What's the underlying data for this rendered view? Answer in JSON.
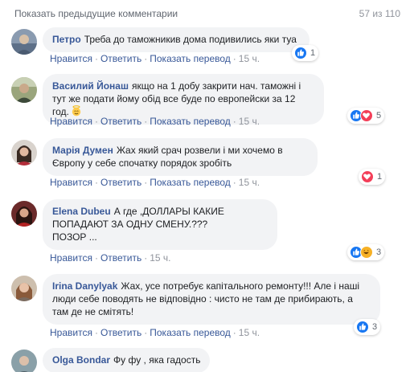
{
  "header": {
    "prev_comments_label": "Показать предыдущие комментарии",
    "count_label": "57 из 110"
  },
  "actions": {
    "like_label": "Нравится",
    "reply_label": "Ответить",
    "translate_label": "Показать перевод"
  },
  "comments": [
    {
      "author": "Петро",
      "text": "Треба до таможникив дома подивились яки туа",
      "translate": true,
      "time": "15 ч.",
      "reactions": [
        "like"
      ],
      "reaction_count": "1"
    },
    {
      "author": "Василий Йонаш",
      "text": "якщо на 1 добу закрити нач. таможні і тут же подати йому обід все буде по европейски за 12 год.",
      "emoji": "smiling-face-with-halo",
      "translate": true,
      "time": "15 ч.",
      "reactions": [
        "like",
        "love"
      ],
      "reaction_count": "5"
    },
    {
      "author": "Марія Думен",
      "text": "Жах який срач розвели і ми хочемо в Європу у себе спочатку порядок зробіть",
      "translate": true,
      "time": "15 ч.",
      "reactions": [
        "love"
      ],
      "reaction_count": "1"
    },
    {
      "author": "Elena Dubeu",
      "text": "А где ,ДОЛЛАРЫ КАКИЕ ПОПАДАЮТ ЗА ОДНУ СМЕНУ.???\nПОЗОР ...",
      "translate": false,
      "time": "15 ч.",
      "reactions": [
        "like",
        "haha"
      ],
      "reaction_count": "3"
    },
    {
      "author": "Irina Danylyak",
      "text": "Жах, усе потребує капітального ремонту!!! Але і наші люди себе поводять не відповідно : чисто не там де прибирають, а там де не смітять!",
      "translate": true,
      "time": "15 ч.",
      "reactions": [
        "like"
      ],
      "reaction_count": "3"
    },
    {
      "author": "Olga Bondar",
      "text": "Фу фу , яка гадость"
    }
  ],
  "colors": {
    "link_blue": "#385898",
    "bubble_gray": "#f2f3f5",
    "meta_gray": "#90949c",
    "like_blue": "#1877f2",
    "love_red": "#f33e58",
    "haha_yellow": "#f7b125"
  }
}
